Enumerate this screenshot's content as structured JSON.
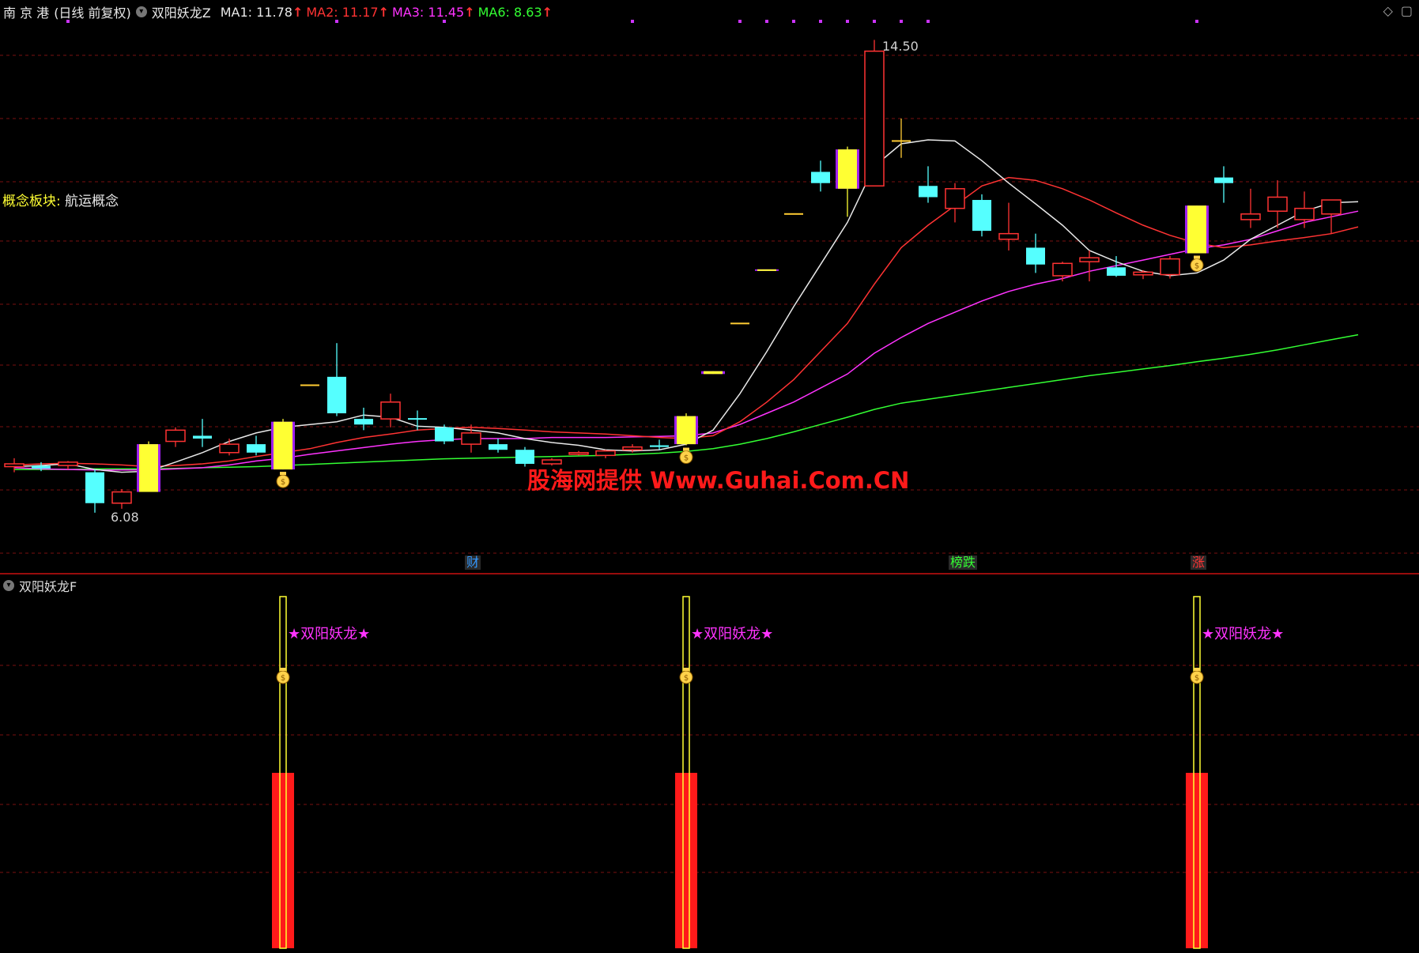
{
  "header": {
    "stock": "南 京 港",
    "mode": "(日线 前复权)",
    "formula": "双阳妖龙Z",
    "indicators": [
      {
        "label": "MA1: 11.78",
        "color": "#e8e8e8"
      },
      {
        "label": "MA2: 11.17",
        "color": "#ff3333"
      },
      {
        "label": "MA3: 11.45",
        "color": "#ff33ff"
      },
      {
        "label": "MA6: 8.63",
        "color": "#33ff33"
      }
    ],
    "arrow": "↑"
  },
  "concept": {
    "key": "概念板块:",
    "value": "航运概念"
  },
  "price_labels": {
    "high": "14.50",
    "low": "6.08"
  },
  "watermark": "股海网提供 Www.Guhai.Com.CN",
  "event_tags": [
    {
      "text": "财",
      "color": "#3399ff"
    },
    {
      "text": "榜跌",
      "color": "#33ff33"
    },
    {
      "text": "涨",
      "color": "#ff3333"
    }
  ],
  "sub_panel": {
    "title": "双阳妖龙F",
    "signal_label": "★双阳妖龙★"
  },
  "colors": {
    "up": "#ff3333",
    "down": "#55ffff",
    "signal": "#ffff33",
    "ma1": "#e8e8e8",
    "ma2": "#ff3333",
    "ma3": "#ff33ff",
    "ma6": "#33ff33",
    "grid": "#7a1010"
  },
  "chart_data": {
    "type": "candlestick",
    "title": "",
    "ylim": [
      5.5,
      15.0
    ],
    "candles": [
      {
        "o": 6.95,
        "h": 7.05,
        "l": 6.8,
        "c": 6.9,
        "k": "up"
      },
      {
        "o": 6.9,
        "h": 6.98,
        "l": 6.82,
        "c": 6.88,
        "k": "down"
      },
      {
        "o": 6.92,
        "h": 7.0,
        "l": 6.85,
        "c": 6.98,
        "k": "up"
      },
      {
        "o": 6.8,
        "h": 6.85,
        "l": 6.08,
        "c": 6.25,
        "k": "down"
      },
      {
        "o": 6.25,
        "h": 6.5,
        "l": 6.15,
        "c": 6.45,
        "k": "up"
      },
      {
        "o": 6.45,
        "h": 7.35,
        "l": 6.45,
        "c": 7.3,
        "k": "signal"
      },
      {
        "o": 7.35,
        "h": 7.6,
        "l": 7.25,
        "c": 7.55,
        "k": "up"
      },
      {
        "o": 7.45,
        "h": 7.75,
        "l": 7.25,
        "c": 7.4,
        "k": "down"
      },
      {
        "o": 7.15,
        "h": 7.4,
        "l": 7.1,
        "c": 7.3,
        "k": "up"
      },
      {
        "o": 7.3,
        "h": 7.45,
        "l": 7.1,
        "c": 7.15,
        "k": "down"
      },
      {
        "o": 6.85,
        "h": 7.75,
        "l": 6.85,
        "c": 7.7,
        "k": "signal"
      },
      {
        "o": 8.35,
        "h": 8.35,
        "l": 8.35,
        "c": 8.35,
        "k": "flat"
      },
      {
        "o": 8.5,
        "h": 9.1,
        "l": 7.8,
        "c": 7.85,
        "k": "down"
      },
      {
        "o": 7.75,
        "h": 7.95,
        "l": 7.55,
        "c": 7.65,
        "k": "down"
      },
      {
        "o": 7.75,
        "h": 8.2,
        "l": 7.6,
        "c": 8.05,
        "k": "up"
      },
      {
        "o": 7.75,
        "h": 7.9,
        "l": 7.55,
        "c": 7.75,
        "k": "down"
      },
      {
        "o": 7.6,
        "h": 7.65,
        "l": 7.3,
        "c": 7.35,
        "k": "down"
      },
      {
        "o": 7.3,
        "h": 7.65,
        "l": 7.15,
        "c": 7.5,
        "k": "up"
      },
      {
        "o": 7.3,
        "h": 7.4,
        "l": 7.15,
        "c": 7.2,
        "k": "down"
      },
      {
        "o": 7.2,
        "h": 7.25,
        "l": 6.9,
        "c": 6.95,
        "k": "down"
      },
      {
        "o": 6.95,
        "h": 7.05,
        "l": 6.92,
        "c": 7.02,
        "k": "up"
      },
      {
        "o": 7.12,
        "h": 7.18,
        "l": 7.1,
        "c": 7.15,
        "k": "up"
      },
      {
        "o": 7.1,
        "h": 7.2,
        "l": 7.05,
        "c": 7.18,
        "k": "up"
      },
      {
        "o": 7.2,
        "h": 7.3,
        "l": 7.15,
        "c": 7.25,
        "k": "up"
      },
      {
        "o": 7.25,
        "h": 7.38,
        "l": 7.2,
        "c": 7.28,
        "k": "down"
      },
      {
        "o": 7.3,
        "h": 7.85,
        "l": 7.28,
        "c": 7.8,
        "k": "signal"
      },
      {
        "o": 8.55,
        "h": 8.6,
        "l": 8.55,
        "c": 8.6,
        "k": "signal"
      },
      {
        "o": 9.45,
        "h": 9.45,
        "l": 9.45,
        "c": 9.45,
        "k": "flat"
      },
      {
        "o": 10.4,
        "h": 10.4,
        "l": 10.4,
        "c": 10.4,
        "k": "signal"
      },
      {
        "o": 11.4,
        "h": 11.4,
        "l": 11.4,
        "c": 11.4,
        "k": "flat"
      },
      {
        "o": 11.95,
        "h": 12.35,
        "l": 11.8,
        "c": 12.15,
        "k": "down"
      },
      {
        "o": 11.85,
        "h": 12.6,
        "l": 11.35,
        "c": 12.55,
        "k": "signal"
      },
      {
        "o": 11.9,
        "h": 14.5,
        "l": 11.9,
        "c": 14.3,
        "k": "up"
      },
      {
        "o": 12.7,
        "h": 13.1,
        "l": 12.4,
        "c": 12.7,
        "k": "flat"
      },
      {
        "o": 11.9,
        "h": 12.25,
        "l": 11.6,
        "c": 11.7,
        "k": "down"
      },
      {
        "o": 11.5,
        "h": 11.95,
        "l": 11.25,
        "c": 11.85,
        "k": "up"
      },
      {
        "o": 11.65,
        "h": 11.75,
        "l": 11.0,
        "c": 11.1,
        "k": "down"
      },
      {
        "o": 10.95,
        "h": 11.6,
        "l": 10.75,
        "c": 11.05,
        "k": "up"
      },
      {
        "o": 10.8,
        "h": 11.05,
        "l": 10.35,
        "c": 10.5,
        "k": "down"
      },
      {
        "o": 10.3,
        "h": 10.55,
        "l": 10.2,
        "c": 10.52,
        "k": "up"
      },
      {
        "o": 10.55,
        "h": 10.75,
        "l": 10.2,
        "c": 10.62,
        "k": "up"
      },
      {
        "o": 10.45,
        "h": 10.65,
        "l": 10.28,
        "c": 10.3,
        "k": "down"
      },
      {
        "o": 10.35,
        "h": 10.4,
        "l": 10.24,
        "c": 10.33,
        "k": "up"
      },
      {
        "o": 10.32,
        "h": 10.65,
        "l": 10.25,
        "c": 10.6,
        "k": "up"
      },
      {
        "o": 10.7,
        "h": 11.55,
        "l": 10.7,
        "c": 11.55,
        "k": "signal"
      },
      {
        "o": 12.05,
        "h": 12.25,
        "l": 11.6,
        "c": 11.95,
        "k": "down"
      },
      {
        "o": 11.3,
        "h": 11.85,
        "l": 11.15,
        "c": 11.4,
        "k": "up"
      },
      {
        "o": 11.45,
        "h": 12.0,
        "l": 11.15,
        "c": 11.7,
        "k": "up"
      },
      {
        "o": 11.3,
        "h": 11.8,
        "l": 11.15,
        "c": 11.5,
        "k": "up"
      },
      {
        "o": 11.4,
        "h": 11.65,
        "l": 11.05,
        "c": 11.65,
        "k": "up"
      }
    ],
    "ma1": [
      6.9,
      6.92,
      6.95,
      6.85,
      6.8,
      6.82,
      6.98,
      7.15,
      7.35,
      7.5,
      7.6,
      7.65,
      7.7,
      7.82,
      7.78,
      7.62,
      7.6,
      7.55,
      7.5,
      7.4,
      7.33,
      7.28,
      7.2,
      7.18,
      7.2,
      7.3,
      7.55,
      8.2,
      8.95,
      9.75,
      10.5,
      11.25,
      12.25,
      12.65,
      12.72,
      12.7,
      12.35,
      11.95,
      11.58,
      11.2,
      10.75,
      10.55,
      10.38,
      10.3,
      10.35,
      10.58,
      10.95,
      11.2,
      11.45,
      11.6,
      11.62
    ],
    "ma2": [
      6.93,
      6.95,
      6.96,
      6.95,
      6.93,
      6.9,
      6.92,
      6.95,
      7.0,
      7.08,
      7.15,
      7.22,
      7.33,
      7.42,
      7.48,
      7.55,
      7.58,
      7.6,
      7.58,
      7.55,
      7.52,
      7.5,
      7.48,
      7.45,
      7.42,
      7.4,
      7.45,
      7.7,
      8.05,
      8.45,
      8.95,
      9.45,
      10.15,
      10.8,
      11.2,
      11.55,
      11.9,
      12.05,
      12.0,
      11.85,
      11.65,
      11.42,
      11.2,
      11.02,
      10.88,
      10.8,
      10.85,
      10.92,
      10.98,
      11.05,
      11.17
    ],
    "ma3": [
      6.88,
      6.86,
      6.85,
      6.84,
      6.84,
      6.84,
      6.86,
      6.88,
      6.93,
      7.0,
      7.05,
      7.12,
      7.18,
      7.24,
      7.3,
      7.35,
      7.38,
      7.4,
      7.4,
      7.4,
      7.42,
      7.42,
      7.42,
      7.43,
      7.44,
      7.45,
      7.5,
      7.65,
      7.85,
      8.05,
      8.3,
      8.55,
      8.92,
      9.2,
      9.45,
      9.65,
      9.85,
      10.02,
      10.15,
      10.25,
      10.38,
      10.48,
      10.58,
      10.68,
      10.78,
      10.85,
      10.95,
      11.1,
      11.25,
      11.35,
      11.45
    ],
    "ma6": [
      6.85,
      6.85,
      6.85,
      6.86,
      6.86,
      6.86,
      6.87,
      6.88,
      6.89,
      6.9,
      6.92,
      6.94,
      6.96,
      6.98,
      7.0,
      7.02,
      7.04,
      7.05,
      7.06,
      7.07,
      7.08,
      7.09,
      7.1,
      7.12,
      7.14,
      7.17,
      7.22,
      7.3,
      7.4,
      7.52,
      7.65,
      7.78,
      7.92,
      8.03,
      8.1,
      8.17,
      8.24,
      8.31,
      8.38,
      8.45,
      8.52,
      8.58,
      8.64,
      8.7,
      8.77,
      8.83,
      8.9,
      8.98,
      9.07,
      9.16,
      9.25
    ],
    "signal_indices": [
      10,
      25,
      44
    ],
    "event_tag_indices": [
      17,
      35,
      44
    ],
    "top_dot_indices": [
      2,
      12,
      16,
      23,
      27,
      28,
      29,
      30,
      31,
      32,
      33,
      34,
      44
    ]
  }
}
